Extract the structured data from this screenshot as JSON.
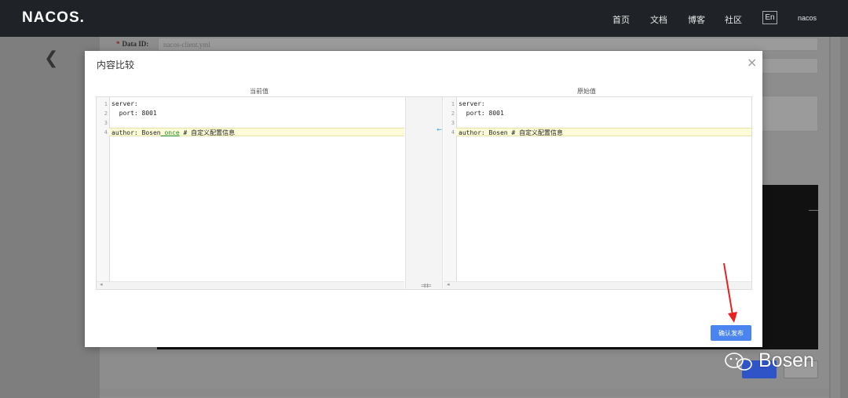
{
  "header": {
    "logo": "NACOS.",
    "nav": [
      "首页",
      "文档",
      "博客",
      "社区"
    ],
    "lang": "En",
    "user": "nacos"
  },
  "background_form": {
    "data_id_label": "Data ID:",
    "required_mark": "*",
    "data_id_value": "nacos-client.yml"
  },
  "modal": {
    "title": "内容比较",
    "close_symbol": "×",
    "current_label": "当前值",
    "original_label": "原始值",
    "current_lines": [
      {
        "num": "1",
        "text": "server:"
      },
      {
        "num": "2",
        "text": "  port: 8001"
      },
      {
        "num": "3",
        "text": ""
      },
      {
        "num": "4",
        "text_before": "author: Bosen",
        "text_added": "_once",
        "text_after": " # 自定义配置信息"
      }
    ],
    "original_lines": [
      {
        "num": "1",
        "text": "server:"
      },
      {
        "num": "2",
        "text": "  port: 8001"
      },
      {
        "num": "3",
        "text": ""
      },
      {
        "num": "4",
        "text": "author: Bosen # 自定义配置信息"
      }
    ],
    "revert_symbol": "⇜",
    "swap_symbol": "⇉⇇",
    "scroll_left": "◂",
    "confirm_button": "确认发布"
  },
  "watermark": "Bosen",
  "colors": {
    "topbar": "#1f2327",
    "primary": "#4a84f0",
    "highlight_line": "#fdfbd8",
    "annotation_arrow": "#e8201f"
  }
}
